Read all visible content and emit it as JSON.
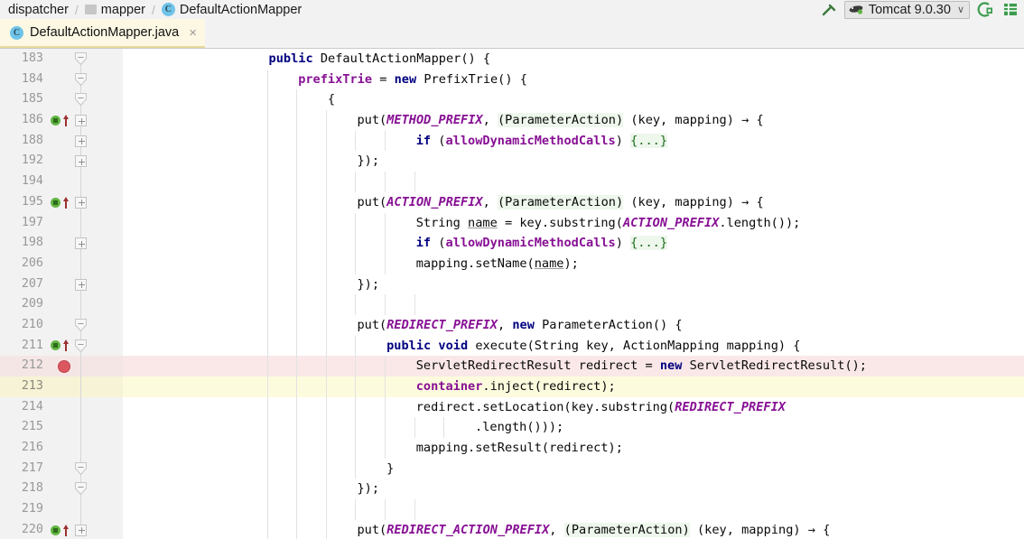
{
  "breadcrumb": {
    "items": [
      {
        "label": "dispatcher",
        "icon": "none"
      },
      {
        "label": "mapper",
        "icon": "package-icon"
      },
      {
        "label": "DefaultActionMapper",
        "icon": "class-icon"
      }
    ],
    "separator": "/"
  },
  "toolbar": {
    "build_icon": "hammer-icon",
    "run_configuration": "Tomcat 9.0.30",
    "run_config_caret": "∨",
    "debug_icon": "debug-icon",
    "database_icon": "database-icon"
  },
  "tab": {
    "label": "DefaultActionMapper.java",
    "icon": "java-class-icon",
    "close": "×"
  },
  "editor": {
    "lines": [
      {
        "no": "183",
        "indent": 4,
        "marker": "none",
        "fold": "arrow-collapse",
        "highlight": "none",
        "tokens": [
          {
            "t": "kw",
            "v": "public"
          },
          {
            "t": "plain",
            "v": " DefaultActionMapper() {"
          }
        ]
      },
      {
        "no": "184",
        "indent": 5,
        "marker": "none",
        "fold": "arrow-collapse",
        "highlight": "none",
        "tokens": [
          {
            "t": "fld",
            "v": "prefixTrie"
          },
          {
            "t": "plain",
            "v": " = "
          },
          {
            "t": "kw",
            "v": "new"
          },
          {
            "t": "plain",
            "v": " PrefixTrie() {"
          }
        ]
      },
      {
        "no": "185",
        "indent": 6,
        "marker": "none",
        "fold": "arrow-collapse",
        "highlight": "none",
        "tokens": [
          {
            "t": "plain",
            "v": "{"
          }
        ]
      },
      {
        "no": "186",
        "indent": 7,
        "marker": "impl-arrow",
        "fold": "plus",
        "highlight": "none",
        "tokens": [
          {
            "t": "plain",
            "v": "put("
          },
          {
            "t": "cst",
            "v": "METHOD_PREFIX"
          },
          {
            "t": "plain",
            "v": ", "
          },
          {
            "t": "fold-lambda",
            "v": "(ParameterAction)"
          },
          {
            "t": "plain",
            "v": " (key, mapping) → {"
          }
        ]
      },
      {
        "no": "188",
        "indent": 9,
        "marker": "none",
        "fold": "plus",
        "highlight": "none",
        "tokens": [
          {
            "t": "kw",
            "v": "if"
          },
          {
            "t": "plain",
            "v": " ("
          },
          {
            "t": "fld",
            "v": "allowDynamicMethodCalls"
          },
          {
            "t": "plain",
            "v": ") "
          },
          {
            "t": "fold-block",
            "v": "{...}"
          }
        ]
      },
      {
        "no": "192",
        "indent": 7,
        "marker": "none",
        "fold": "plus",
        "highlight": "none",
        "tokens": [
          {
            "t": "plain",
            "v": "});"
          }
        ]
      },
      {
        "no": "194",
        "indent": 0,
        "marker": "none",
        "fold": "none",
        "highlight": "none",
        "tokens": []
      },
      {
        "no": "195",
        "indent": 7,
        "marker": "impl-arrow",
        "fold": "plus",
        "highlight": "none",
        "tokens": [
          {
            "t": "plain",
            "v": "put("
          },
          {
            "t": "cst",
            "v": "ACTION_PREFIX"
          },
          {
            "t": "plain",
            "v": ", "
          },
          {
            "t": "fold-lambda",
            "v": "(ParameterAction)"
          },
          {
            "t": "plain",
            "v": " (key, mapping) → {"
          }
        ]
      },
      {
        "no": "197",
        "indent": 9,
        "marker": "none",
        "fold": "none",
        "highlight": "none",
        "tokens": [
          {
            "t": "plain",
            "v": "String "
          },
          {
            "t": "ul",
            "v": "name"
          },
          {
            "t": "plain",
            "v": " = key.substring("
          },
          {
            "t": "cst",
            "v": "ACTION_PREFIX"
          },
          {
            "t": "plain",
            "v": ".length());"
          }
        ]
      },
      {
        "no": "198",
        "indent": 9,
        "marker": "none",
        "fold": "plus",
        "highlight": "none",
        "tokens": [
          {
            "t": "kw",
            "v": "if"
          },
          {
            "t": "plain",
            "v": " ("
          },
          {
            "t": "fld",
            "v": "allowDynamicMethodCalls"
          },
          {
            "t": "plain",
            "v": ") "
          },
          {
            "t": "fold-block",
            "v": "{...}"
          }
        ]
      },
      {
        "no": "206",
        "indent": 9,
        "marker": "none",
        "fold": "none",
        "highlight": "none",
        "tokens": [
          {
            "t": "plain",
            "v": "mapping.setName("
          },
          {
            "t": "ul",
            "v": "name"
          },
          {
            "t": "plain",
            "v": ");"
          }
        ]
      },
      {
        "no": "207",
        "indent": 7,
        "marker": "none",
        "fold": "plus",
        "highlight": "none",
        "tokens": [
          {
            "t": "plain",
            "v": "});"
          }
        ]
      },
      {
        "no": "209",
        "indent": 0,
        "marker": "none",
        "fold": "none",
        "highlight": "none",
        "tokens": []
      },
      {
        "no": "210",
        "indent": 7,
        "marker": "none",
        "fold": "arrow-collapse",
        "highlight": "none",
        "tokens": [
          {
            "t": "plain",
            "v": "put("
          },
          {
            "t": "cst",
            "v": "REDIRECT_PREFIX"
          },
          {
            "t": "plain",
            "v": ", "
          },
          {
            "t": "kw",
            "v": "new"
          },
          {
            "t": "plain",
            "v": " ParameterAction() {"
          }
        ]
      },
      {
        "no": "211",
        "indent": 8,
        "marker": "impl-arrow",
        "fold": "arrow-collapse",
        "highlight": "none",
        "tokens": [
          {
            "t": "kw",
            "v": "public void"
          },
          {
            "t": "plain",
            "v": " execute(String key, ActionMapping mapping) {"
          }
        ]
      },
      {
        "no": "212",
        "indent": 9,
        "marker": "breakpoint",
        "fold": "none",
        "highlight": "breakpoint",
        "tokens": [
          {
            "t": "plain",
            "v": "ServletRedirectResult redirect = "
          },
          {
            "t": "kw",
            "v": "new"
          },
          {
            "t": "plain",
            "v": " ServletRedirectResult();"
          }
        ]
      },
      {
        "no": "213",
        "indent": 9,
        "marker": "none",
        "fold": "none",
        "highlight": "caret",
        "tokens": [
          {
            "t": "fld",
            "v": "container"
          },
          {
            "t": "plain",
            "v": ".inject(redirect);"
          }
        ]
      },
      {
        "no": "214",
        "indent": 9,
        "marker": "none",
        "fold": "none",
        "highlight": "none",
        "tokens": [
          {
            "t": "plain",
            "v": "redirect.setLocation(key.substring("
          },
          {
            "t": "cst",
            "v": "REDIRECT_PREFIX"
          }
        ]
      },
      {
        "no": "215",
        "indent": 11,
        "marker": "none",
        "fold": "none",
        "highlight": "none",
        "tokens": [
          {
            "t": "plain",
            "v": ".length()));"
          }
        ]
      },
      {
        "no": "216",
        "indent": 9,
        "marker": "none",
        "fold": "none",
        "highlight": "none",
        "tokens": [
          {
            "t": "plain",
            "v": "mapping.setResult(redirect);"
          }
        ]
      },
      {
        "no": "217",
        "indent": 8,
        "marker": "none",
        "fold": "arrow-collapse",
        "highlight": "none",
        "tokens": [
          {
            "t": "plain",
            "v": "}"
          }
        ]
      },
      {
        "no": "218",
        "indent": 7,
        "marker": "none",
        "fold": "arrow-collapse",
        "highlight": "none",
        "tokens": [
          {
            "t": "plain",
            "v": "});"
          }
        ]
      },
      {
        "no": "219",
        "indent": 0,
        "marker": "none",
        "fold": "none",
        "highlight": "none",
        "tokens": []
      },
      {
        "no": "220",
        "indent": 7,
        "marker": "impl-arrow",
        "fold": "plus",
        "highlight": "none",
        "tokens": [
          {
            "t": "plain",
            "v": "put("
          },
          {
            "t": "cst",
            "v": "REDIRECT_ACTION_PREFIX"
          },
          {
            "t": "plain",
            "v": ", "
          },
          {
            "t": "fold-lambda",
            "v": "(ParameterAction)"
          },
          {
            "t": "plain",
            "v": " (key, mapping) → {"
          }
        ]
      }
    ],
    "indent_guide_columns": [
      4,
      5,
      6,
      7,
      8,
      9,
      10,
      11
    ]
  },
  "colors": {
    "keyword": "#000080",
    "constant": "#871094",
    "field": "#871094",
    "breakpoint_row": "#fae8e8",
    "caret_row": "#fdfbdd",
    "gutter": "#f2f2f2",
    "tab_active": "#fcf8e3",
    "impl_marker": "#62b543",
    "breakpoint_marker": "#db5860"
  }
}
